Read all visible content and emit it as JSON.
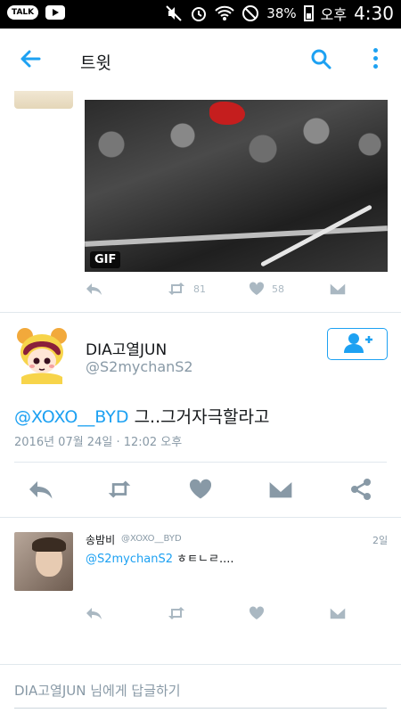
{
  "status_bar": {
    "talk_badge": "TALK",
    "battery_percent": "38%",
    "ampm": "오후",
    "time": "4:30"
  },
  "app_bar": {
    "title": "트윗"
  },
  "previous_tweet": {
    "gif_badge": "GIF",
    "retweets": "81",
    "likes": "58"
  },
  "main_tweet": {
    "display_name": "DIA고열JUN",
    "handle": "@S2mychanS2",
    "mention": "@XOXO__BYD",
    "text": " 그..그거자극할라고",
    "timestamp": "2016년 07월 24일 · 12:02 오후"
  },
  "reply_tweet": {
    "display_name": "송밤비",
    "handle": "@XOXO__BYD",
    "age": "2일",
    "mention": "@S2mychanS2",
    "text": " ㅎㅌㄴㄹ...."
  },
  "reply_box": {
    "placeholder": "DIA고열JUN 님에게 답글하기"
  },
  "colors": {
    "accent": "#1da1f2",
    "muted_icon": "#aab8c2",
    "main_icon": "#8899a6"
  }
}
